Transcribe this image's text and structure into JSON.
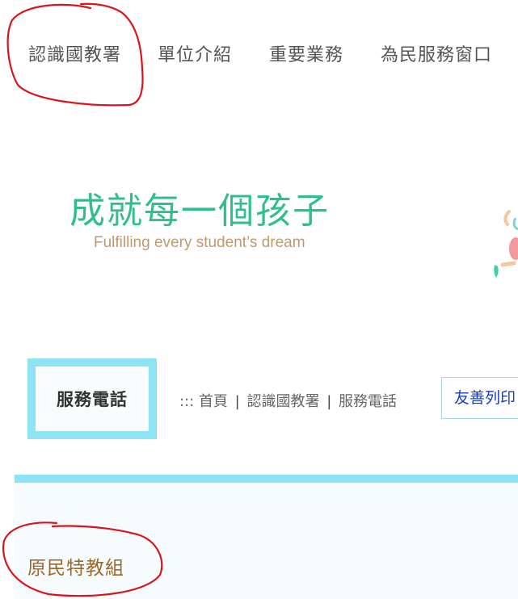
{
  "nav": {
    "items": [
      {
        "label": "認識國教署"
      },
      {
        "label": "單位介紹"
      },
      {
        "label": "重要業務"
      },
      {
        "label": "為民服務窗口"
      }
    ]
  },
  "banner": {
    "slogan": "成就每一個孩子",
    "tagline": "Fulfilling every student’s dream"
  },
  "page": {
    "title": "服務電話"
  },
  "breadcrumb": {
    "prefix": ":::",
    "items": [
      "首頁",
      "認識國教署",
      "服務電話"
    ],
    "separator": "|"
  },
  "toolbar": {
    "print_label": "友善列印"
  },
  "content": {
    "section_heading": "原民特教組"
  },
  "colors": {
    "slogan": "#2fbf8f",
    "tagline": "#c09a6e",
    "accent_cyan": "#8ee3f5",
    "link_blue": "#1a3cc7",
    "heading_brown": "#9a6a2a",
    "annotation_red": "#d9141c"
  }
}
